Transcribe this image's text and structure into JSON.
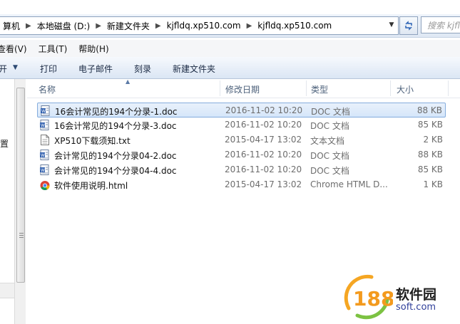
{
  "address_bar": {
    "crumbs": [
      "算机",
      "本地磁盘 (D:)",
      "新建文件夹",
      "kjfldq.xp510.com",
      "kjfldq.xp510.com"
    ],
    "search_placeholder": "搜索 kjfl"
  },
  "menu": {
    "view": "查看(V)",
    "tools": "工具(T)",
    "help": "帮助(H)"
  },
  "toolbar": {
    "open": "开",
    "print": "打印",
    "email": "电子邮件",
    "burn": "刻录",
    "new_folder": "新建文件夹"
  },
  "nav": {
    "partial_label": "置"
  },
  "columns": {
    "name": "名称",
    "date": "修改日期",
    "type": "类型",
    "size": "大小"
  },
  "files": [
    {
      "name": "16会计常见的194个分录-1.doc",
      "date": "2016-11-02 10:20",
      "type": "DOC 文档",
      "size": "88 KB",
      "icon": "doc-icon",
      "selected": true
    },
    {
      "name": "16会计常见的194个分录-3.doc",
      "date": "2016-11-02 10:20",
      "type": "DOC 文档",
      "size": "85 KB",
      "icon": "doc-icon",
      "selected": false
    },
    {
      "name": "XP510下载须知.txt",
      "date": "2015-04-17 13:02",
      "type": "文本文档",
      "size": "2 KB",
      "icon": "txt-icon",
      "selected": false
    },
    {
      "name": "会计常见的194个分录04-2.doc",
      "date": "2016-11-02 10:20",
      "type": "DOC 文档",
      "size": "88 KB",
      "icon": "doc-icon",
      "selected": false
    },
    {
      "name": "会计常见的194个分录04-4.doc",
      "date": "2016-11-02 10:20",
      "type": "DOC 文档",
      "size": "85 KB",
      "icon": "doc-icon",
      "selected": false
    },
    {
      "name": "软件使用说明.html",
      "date": "2015-04-17 13:02",
      "type": "Chrome HTML D...",
      "size": "1 KB",
      "icon": "chrome-icon",
      "selected": false
    }
  ],
  "watermark": {
    "logo_text": "188",
    "name": "软件园",
    "url": "soft.com"
  }
}
